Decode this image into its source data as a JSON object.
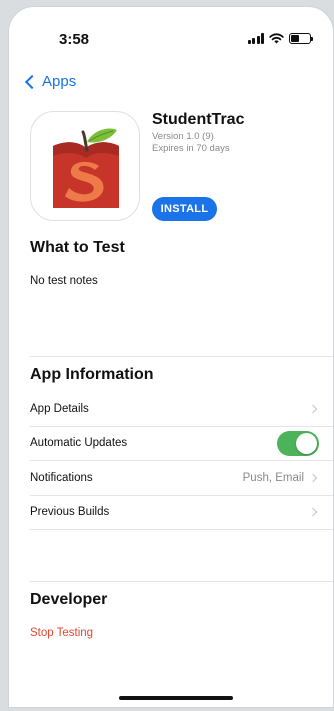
{
  "status_bar": {
    "time": "3:58"
  },
  "nav": {
    "back_label": "Apps"
  },
  "app": {
    "name": "StudentTrac",
    "version": "Version 1.0 (9)",
    "expires": "Expires in 70 days",
    "install_label": "INSTALL",
    "icon_name": "studenttrac-apple-icon"
  },
  "what_to_test": {
    "title": "What to Test",
    "notes": "No test notes"
  },
  "app_information": {
    "title": "App Information",
    "rows": [
      {
        "label": "App Details",
        "value": ""
      },
      {
        "label": "Automatic Updates",
        "toggle_on": true
      },
      {
        "label": "Notifications",
        "value": "Push, Email"
      },
      {
        "label": "Previous Builds",
        "value": ""
      }
    ]
  },
  "developer": {
    "title": "Developer",
    "stop_testing": "Stop Testing"
  },
  "colors": {
    "accent": "#1a73e8",
    "toggle_on": "#4cb35a",
    "destructive": "#e5472f"
  }
}
